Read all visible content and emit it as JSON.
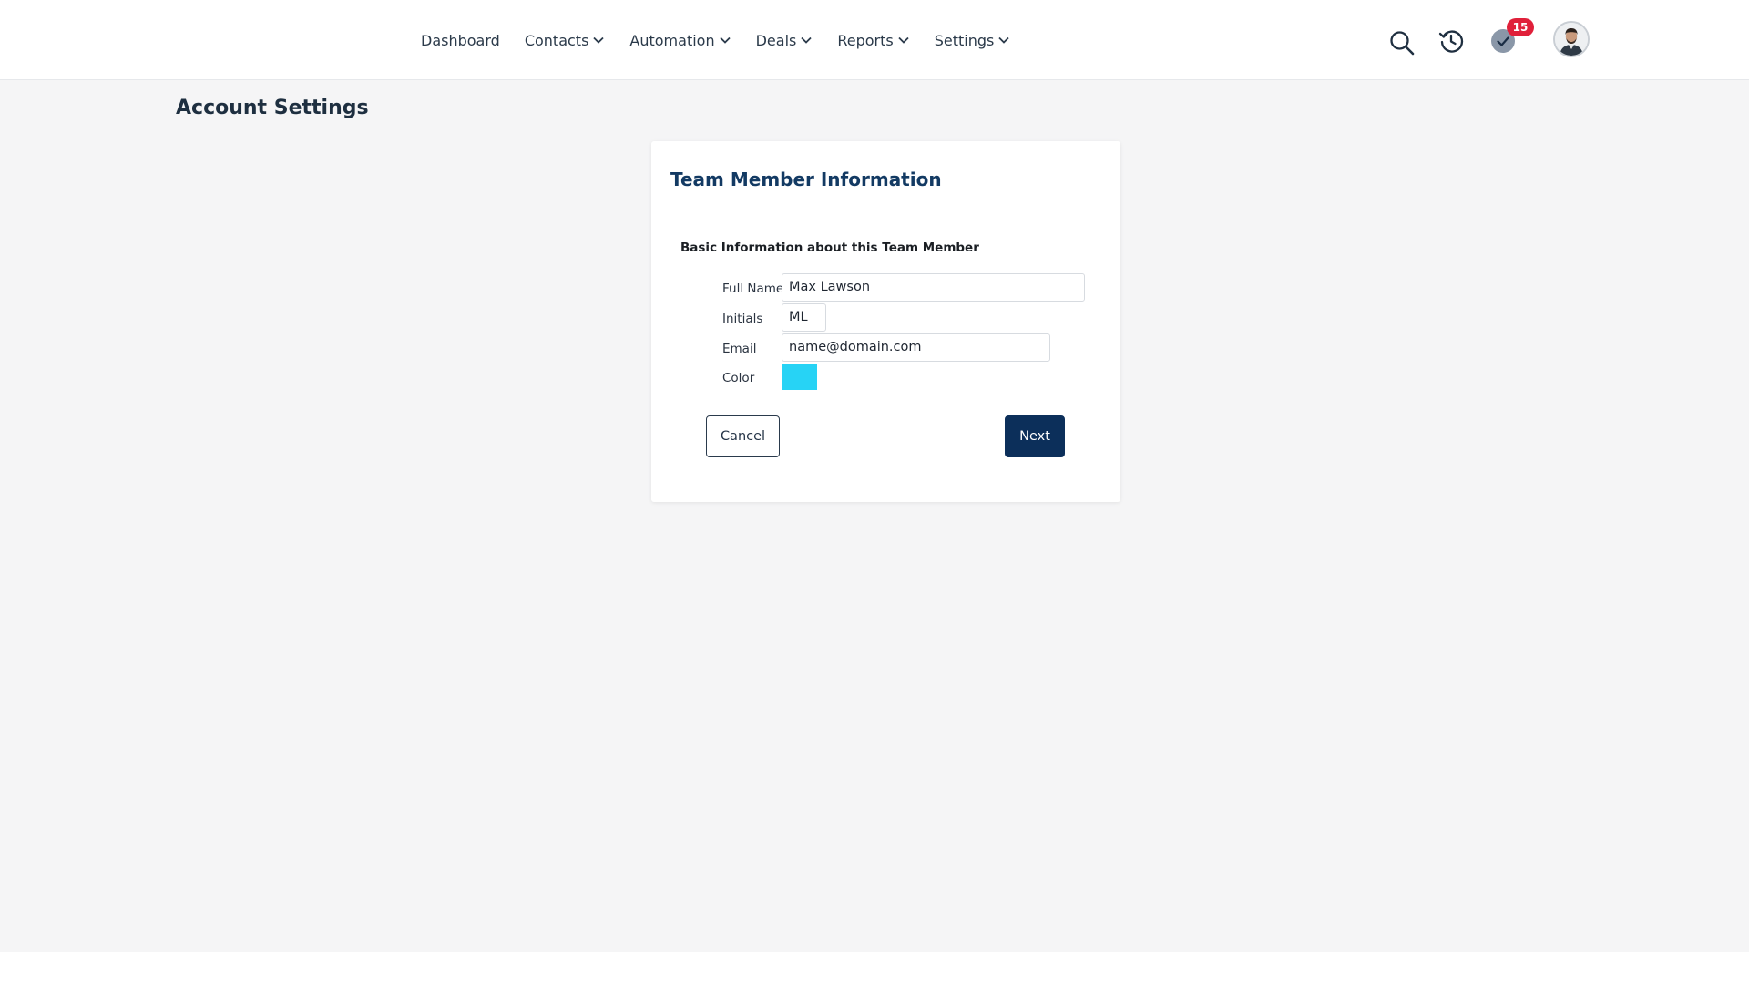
{
  "nav": {
    "items": [
      {
        "label": "Dashboard",
        "has_dropdown": false
      },
      {
        "label": "Contacts",
        "has_dropdown": true
      },
      {
        "label": "Automation",
        "has_dropdown": true
      },
      {
        "label": "Deals",
        "has_dropdown": true
      },
      {
        "label": "Reports",
        "has_dropdown": true
      },
      {
        "label": "Settings",
        "has_dropdown": true
      }
    ]
  },
  "header": {
    "icons": [
      "search-icon",
      "history-icon",
      "check-circle-icon",
      "avatar"
    ],
    "tasks_badge": "15"
  },
  "page": {
    "title": "Account Settings"
  },
  "card": {
    "title": "Team Member Information",
    "section_title": "Basic Information about this Team Member",
    "fields": {
      "full_name_label": "Full Name",
      "full_name_value": "Max Lawson",
      "initials_label": "Initials",
      "initials_value": "ML",
      "email_label": "Email",
      "email_value": "name@domain.com",
      "color_label": "Color",
      "color_value": "#27d3f5"
    },
    "cancel_label": "Cancel",
    "next_label": "Next"
  },
  "colors": {
    "primary": "#0c2f5a",
    "card_title": "#133a63",
    "badge": "#e0203a",
    "background": "#f5f5f6"
  }
}
